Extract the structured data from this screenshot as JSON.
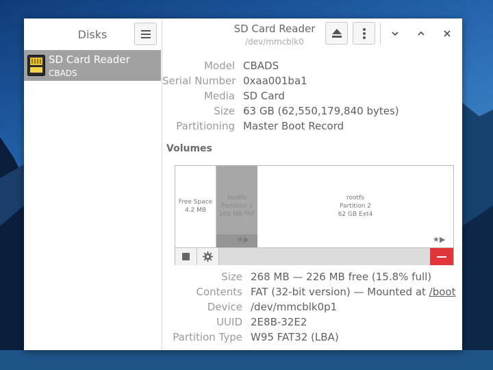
{
  "sidebar": {
    "title": "Disks",
    "disks": [
      {
        "name": "SD Card Reader",
        "sub": "CBADS"
      }
    ]
  },
  "header": {
    "title": "SD Card Reader",
    "subtitle": "/dev/mmcblk0"
  },
  "drive": {
    "model_label": "Model",
    "model": "CBADS",
    "serial_label": "Serial Number",
    "serial": "0xaa001ba1",
    "media_label": "Media",
    "media": "SD Card",
    "size_label": "Size",
    "size": "63 GB (62,550,179,840 bytes)",
    "partitioning_label": "Partitioning",
    "partitioning": "Master Boot Record"
  },
  "volumes": {
    "heading": "Volumes",
    "segments": [
      {
        "line1": "Free Space",
        "line2": "4.2 MB"
      },
      {
        "line1": "bootfs",
        "line2": "Partition 1",
        "line3": "268 MB FAT"
      },
      {
        "line1": "rootfs",
        "line2": "Partition 2",
        "line3": "62 GB Ext4"
      }
    ]
  },
  "partition": {
    "size_label": "Size",
    "size": "268 MB — 226 MB free (15.8% full)",
    "contents_label": "Contents",
    "contents_prefix": "FAT (32-bit version) — Mounted at ",
    "mount_link": "/boot",
    "device_label": "Device",
    "device": "/dev/mmcblk0p1",
    "uuid_label": "UUID",
    "uuid": "2E8B-32E2",
    "type_label": "Partition Type",
    "type": "W95 FAT32 (LBA)"
  },
  "colors": {
    "selection": "#a1a1a1",
    "delete": "#e0353a"
  }
}
